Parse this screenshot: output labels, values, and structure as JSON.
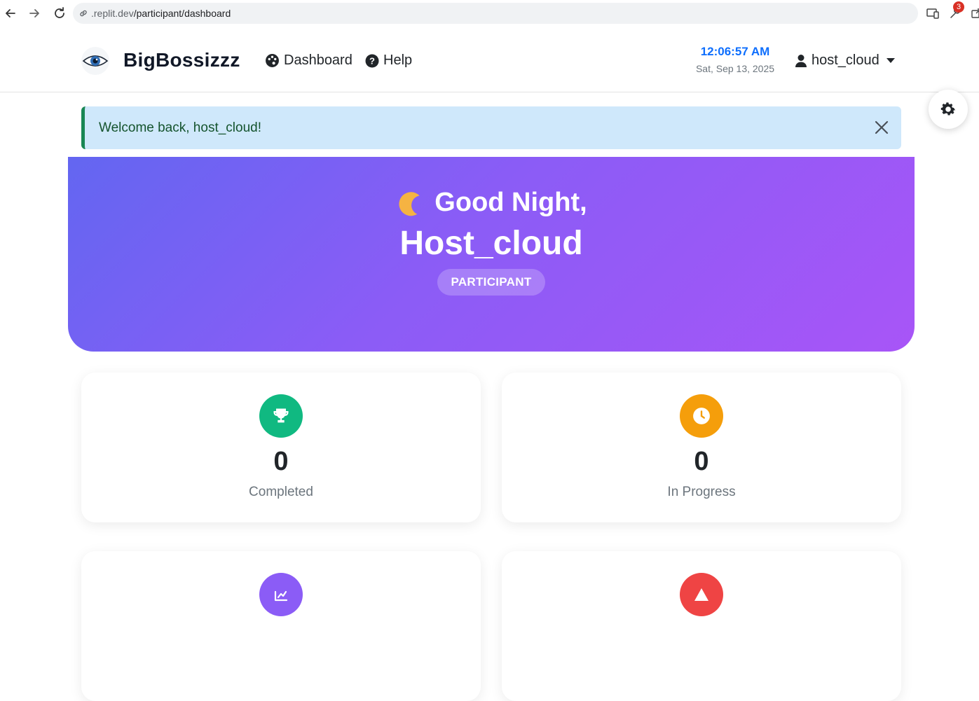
{
  "browser": {
    "url_host": ".replit.dev",
    "url_path": "/participant/dashboard",
    "extension_badge": "3"
  },
  "navbar": {
    "brand": "BigBossizzz",
    "links": [
      {
        "label": "Dashboard",
        "icon": "palette-icon"
      },
      {
        "label": "Help",
        "icon": "question-circle-icon"
      }
    ],
    "time": "12:06:57 AM",
    "date": "Sat, Sep 13, 2025",
    "user": "host_cloud"
  },
  "alert": {
    "message": "Welcome back, host_cloud!"
  },
  "hero": {
    "greeting": "Good Night,",
    "name": "Host_cloud",
    "role": "PARTICIPANT",
    "gradient": [
      "#6366f1",
      "#a855f7"
    ]
  },
  "stats": [
    {
      "value": "0",
      "label": "Completed",
      "icon": "trophy-icon",
      "color": "#10b981"
    },
    {
      "value": "0",
      "label": "In Progress",
      "icon": "clock-icon",
      "color": "#f59e0b"
    },
    {
      "value": "",
      "label": "",
      "icon": "chart-icon",
      "color": "#8b5cf6"
    },
    {
      "value": "",
      "label": "",
      "icon": "alert-icon",
      "color": "#ef4444"
    }
  ]
}
